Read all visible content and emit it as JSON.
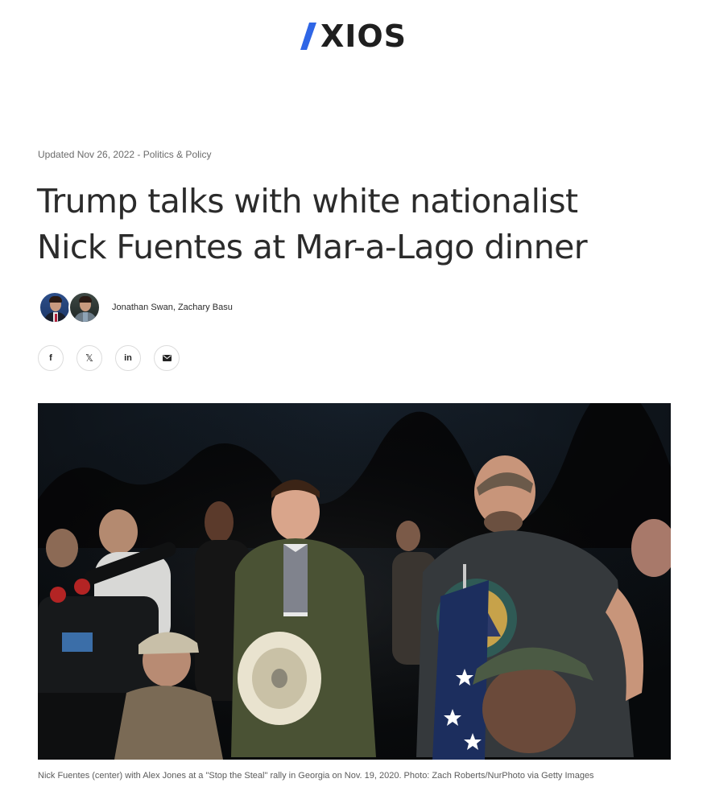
{
  "header": {
    "logo_text": "XIOS",
    "brand_color": "#2f66e6"
  },
  "article": {
    "meta": "Updated Nov 26, 2022 - Politics & Policy",
    "headline_line1": "Trump talks with white nationalist",
    "headline_line2": "Nick Fuentes at Mar-a-Lago dinner",
    "byline": "Jonathan Swan, Zachary Basu",
    "share": {
      "facebook": "f",
      "twitter": "𝕏",
      "linkedin": "in",
      "email": "email-icon"
    },
    "caption": "Nick Fuentes (center) with Alex Jones at a \"Stop the Steal\" rally in Georgia on Nov. 19, 2020. Photo: Zach Roberts/NurPhoto via Getty Images"
  }
}
